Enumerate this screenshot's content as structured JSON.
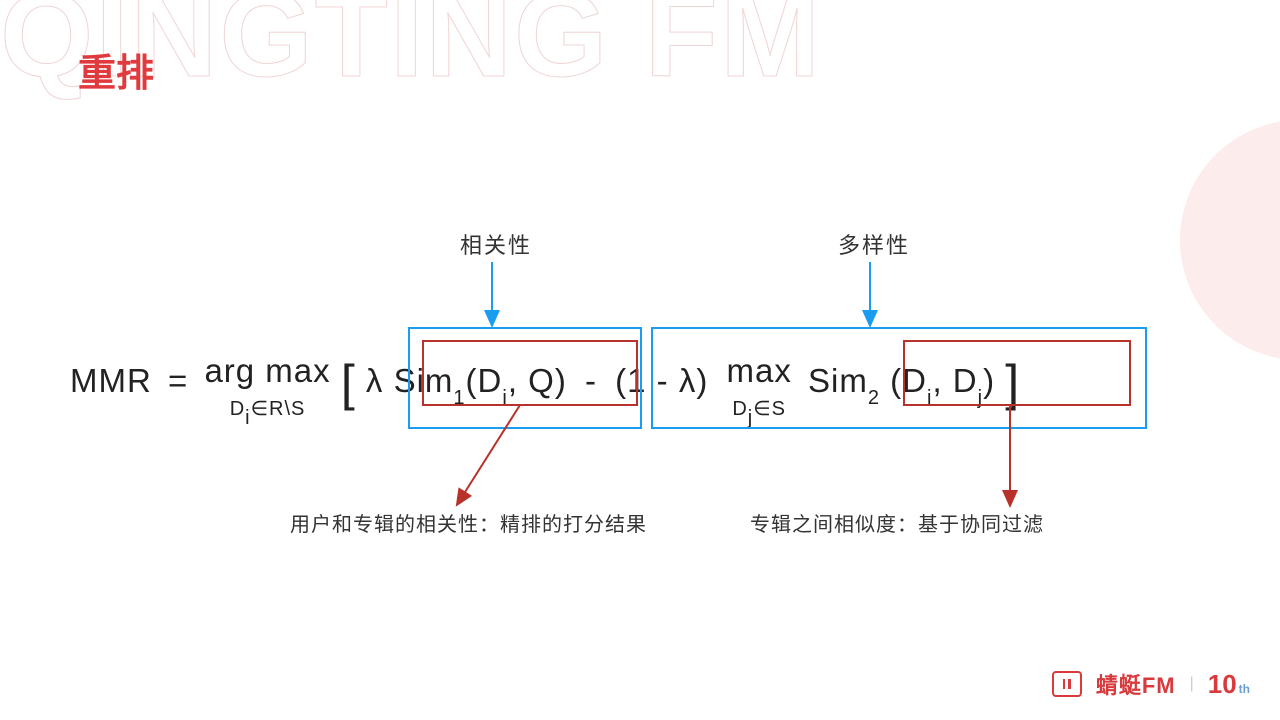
{
  "bg_text": "QINGTING FM",
  "title": "重排",
  "labels": {
    "relevance": "相关性",
    "diversity": "多样性"
  },
  "descriptions": {
    "left": "用户和专辑的相关性：精排的打分结果",
    "right": "专辑之间相似度：基于协同过滤"
  },
  "formula": {
    "mmr": "MMR",
    "eq": "=",
    "argmax_top": "arg max",
    "argmax_bot": "D",
    "argmax_bot_sub": "i",
    "argmax_bot_tail": "∈R\\S",
    "lbracket": "[",
    "lambda1": "λ",
    "sim1": "Sim",
    "sim1_sub": "1",
    "sim1_args_a": "(D",
    "sim1_args_a_sub": "i",
    "sim1_args_b": ", Q)",
    "minus": "-",
    "one_minus_lambda": "(1 - λ)",
    "max2_top": "max",
    "max2_bot": "D",
    "max2_bot_sub": "j",
    "max2_bot_tail": "∈S",
    "sim2": "Sim",
    "sim2_sub": "2",
    "sim2_args_a": " (D",
    "sim2_args_a_sub": "i",
    "sim2_args_b": ", D",
    "sim2_args_b_sub": "j",
    "sim2_args_c": ")",
    "rbracket": "]"
  },
  "footer": {
    "brand": "蜻蜓FM",
    "ten": "10",
    "th": "th"
  }
}
